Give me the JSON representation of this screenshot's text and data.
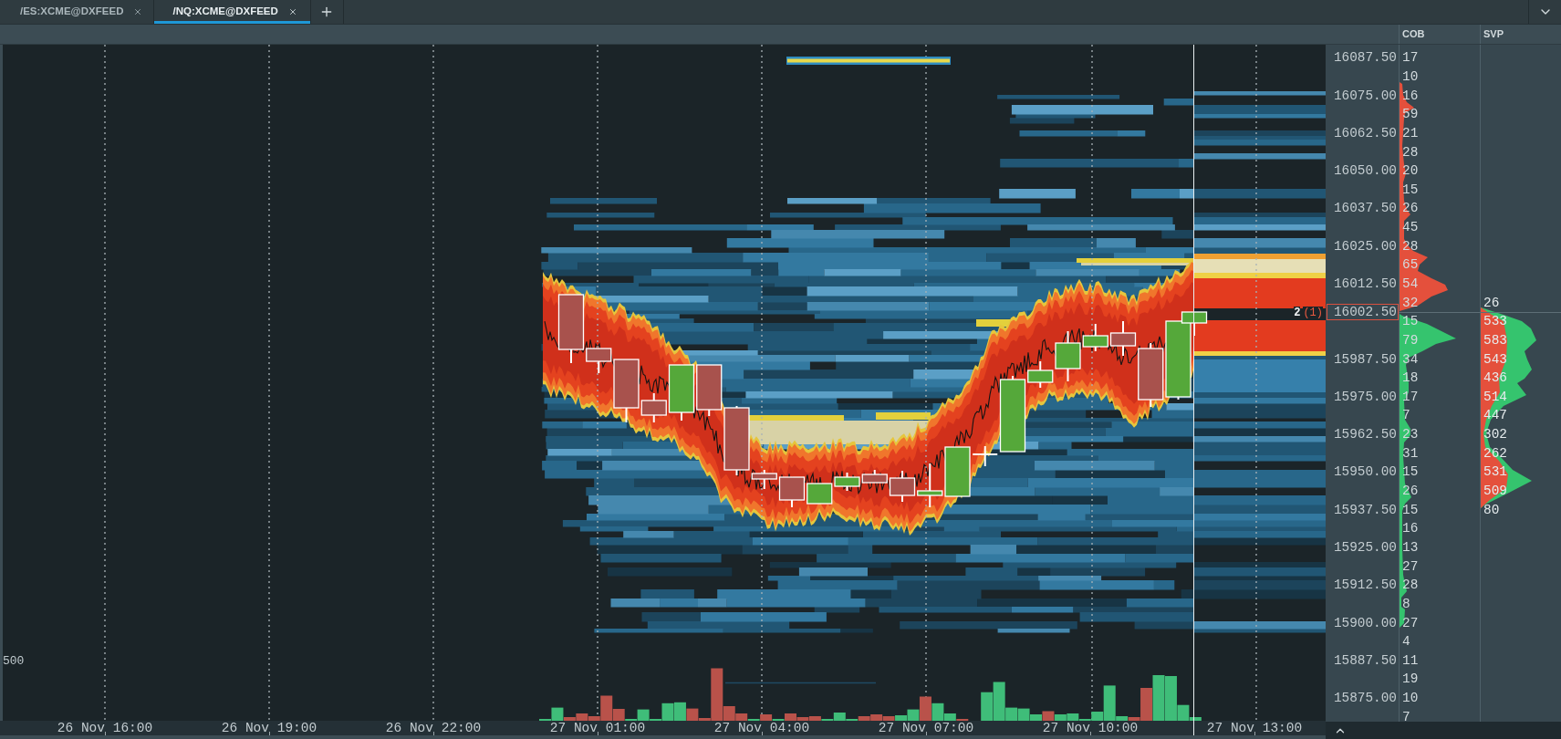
{
  "tabs": [
    {
      "label": "/ES:XCME@DXFEED",
      "selected": false
    },
    {
      "label": "/NQ:XCME@DXFEED",
      "selected": true
    }
  ],
  "panel_headers": [
    "COB",
    "SVP"
  ],
  "chart": {
    "volume_axis_label": "500",
    "order_marker": {
      "size": "2",
      "count": "(1)"
    },
    "time_labels": [
      "26 Nov 16:00",
      "26 Nov 19:00",
      "26 Nov 22:00",
      "27 Nov 01:00",
      "27 Nov 04:00",
      "27 Nov 07:00",
      "27 Nov 10:00",
      "27 Nov 13:00"
    ]
  },
  "ladder": {
    "current_price": "16002.50",
    "asks": [
      {
        "price": "16087.50",
        "cob": "17"
      },
      {
        "cob": "10"
      },
      {
        "price": "16075.00",
        "cob": "16"
      },
      {
        "cob": "59"
      },
      {
        "price": "16062.50",
        "cob": "21"
      },
      {
        "cob": "28"
      },
      {
        "price": "16050.00",
        "cob": "20"
      },
      {
        "cob": "15"
      },
      {
        "price": "16037.50",
        "cob": "26"
      },
      {
        "cob": "45"
      },
      {
        "price": "16025.00",
        "cob": "28"
      },
      {
        "cob": "65"
      },
      {
        "price": "16012.50",
        "cob": "54"
      },
      {
        "cob": "32",
        "svp": "26"
      }
    ],
    "bids": [
      {
        "cob": "15",
        "svp": "533"
      },
      {
        "cob": "79",
        "svp": "583"
      },
      {
        "price": "15987.50",
        "cob": "34",
        "svp": "543"
      },
      {
        "cob": "18",
        "svp": "436"
      },
      {
        "price": "15975.00",
        "cob": "17",
        "svp": "514"
      },
      {
        "cob": "7",
        "svp": "447"
      },
      {
        "price": "15962.50",
        "cob": "23",
        "svp": "302"
      },
      {
        "cob": "31",
        "svp": "262"
      },
      {
        "price": "15950.00",
        "cob": "15",
        "svp": "531"
      },
      {
        "cob": "26",
        "svp": "509"
      },
      {
        "price": "15937.50",
        "cob": "15",
        "svp": "80"
      },
      {
        "cob": "16"
      },
      {
        "price": "15925.00",
        "cob": "13"
      },
      {
        "cob": "27"
      },
      {
        "price": "15912.50",
        "cob": "28"
      },
      {
        "cob": "8"
      },
      {
        "price": "15900.00",
        "cob": "27"
      },
      {
        "cob": "4"
      },
      {
        "price": "15887.50",
        "cob": "11"
      },
      {
        "cob": "19"
      },
      {
        "price": "15875.00",
        "cob": "10"
      },
      {
        "cob": "7"
      }
    ]
  }
}
